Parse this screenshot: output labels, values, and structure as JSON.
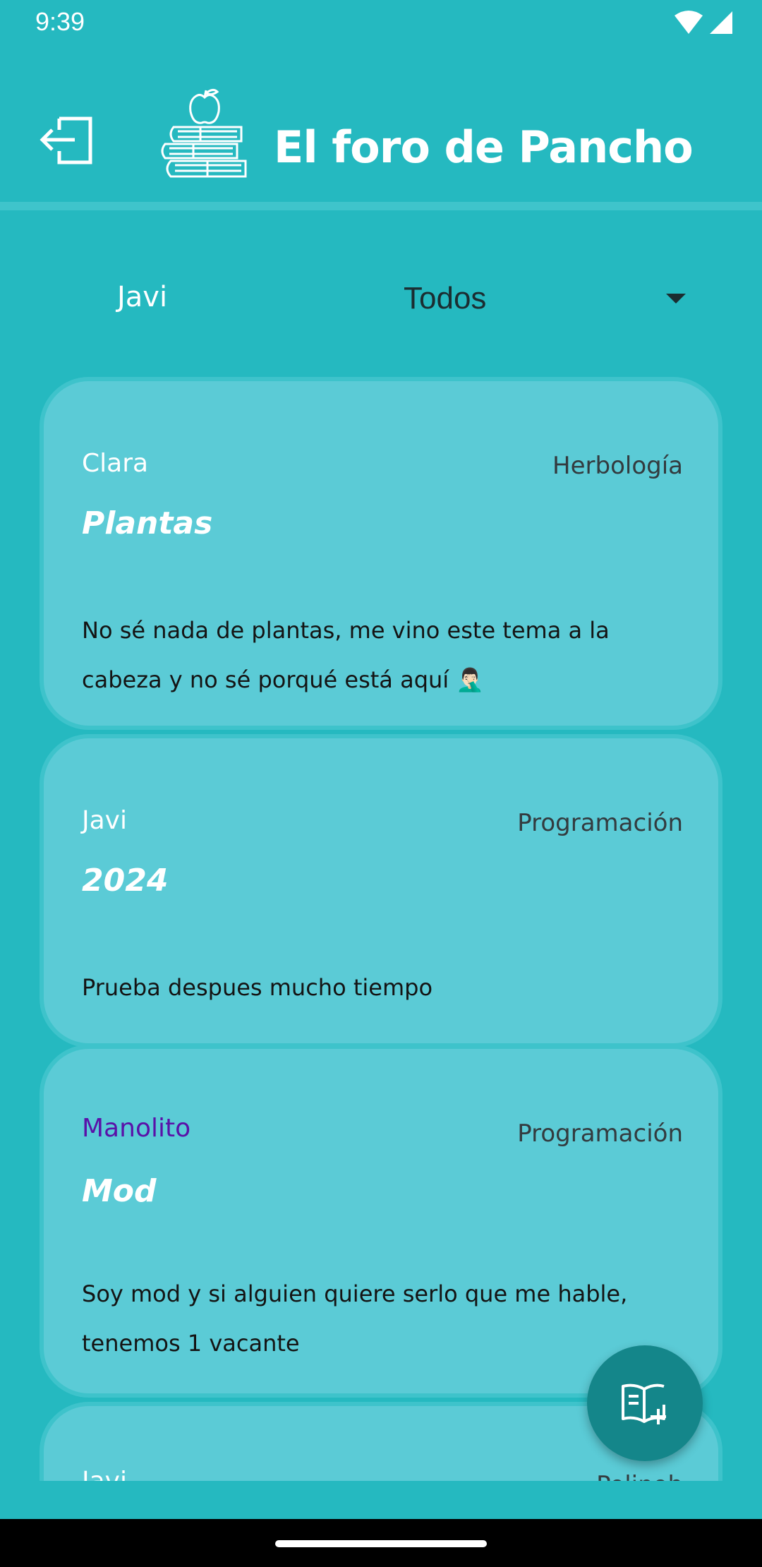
{
  "status_bar": {
    "time": "9:39"
  },
  "app_bar": {
    "title": "El foro de Pancho"
  },
  "filter_bar": {
    "current_user": "Javi",
    "category_filter": "Todos"
  },
  "posts": [
    {
      "author": "Clara",
      "category": "Herbología",
      "title": "Plantas",
      "body": "No sé nada de plantas, me vino este tema a la cabeza y no sé porqué está aquí 🤦🏻‍♂️"
    },
    {
      "author": "Javi",
      "category": "Programación",
      "title": "2024",
      "body": "Prueba despues mucho tiempo"
    },
    {
      "author": "Manolito",
      "category": "Programación",
      "title": "Mod",
      "body": "Soy mod y si alguien quiere serlo que me hable, tenemos 1 vacante"
    },
    {
      "author": "Javi",
      "category": "Polinoh"
    }
  ],
  "colors": {
    "background": "#25b9c0",
    "card": "#5bcbd6",
    "fab": "#14868a",
    "moderator_name": "#5a11a8"
  },
  "icons": {
    "logout": "logout-icon",
    "logo": "books-apple-icon",
    "dropdown": "caret-down-icon",
    "fab": "new-post-book-icon"
  }
}
